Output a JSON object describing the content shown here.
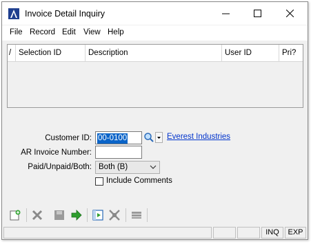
{
  "window": {
    "title": "Invoice Detail Inquiry",
    "minimize_glyph": "—",
    "maximize_glyph": "☐",
    "close_glyph": "✕"
  },
  "menu": [
    "File",
    "Record",
    "Edit",
    "View",
    "Help"
  ],
  "grid": {
    "columns": [
      "/",
      "Selection ID",
      "Description",
      "User ID",
      "Pri?"
    ],
    "rows": []
  },
  "form": {
    "customer_id_label": "Customer ID:",
    "customer_id_value": "00-0100",
    "customer_name": "Everest Industries",
    "ar_invoice_label": "AR Invoice Number:",
    "ar_invoice_value": "",
    "paid_label": "Paid/Unpaid/Both:",
    "paid_value": "Both (B)",
    "include_comments_label": "Include Comments",
    "include_comments_checked": false
  },
  "toolbar": {
    "icons": [
      "new-icon",
      "delete-icon",
      "save-icon",
      "go-icon",
      "preview-icon",
      "expand-icon",
      "collapse-icon"
    ]
  },
  "status": {
    "panels": [
      "",
      "",
      "",
      "INQ",
      "EXP"
    ]
  },
  "colors": {
    "selection": "#0a64c8",
    "link": "#0033cc",
    "accent_green": "#2e9e2e"
  }
}
